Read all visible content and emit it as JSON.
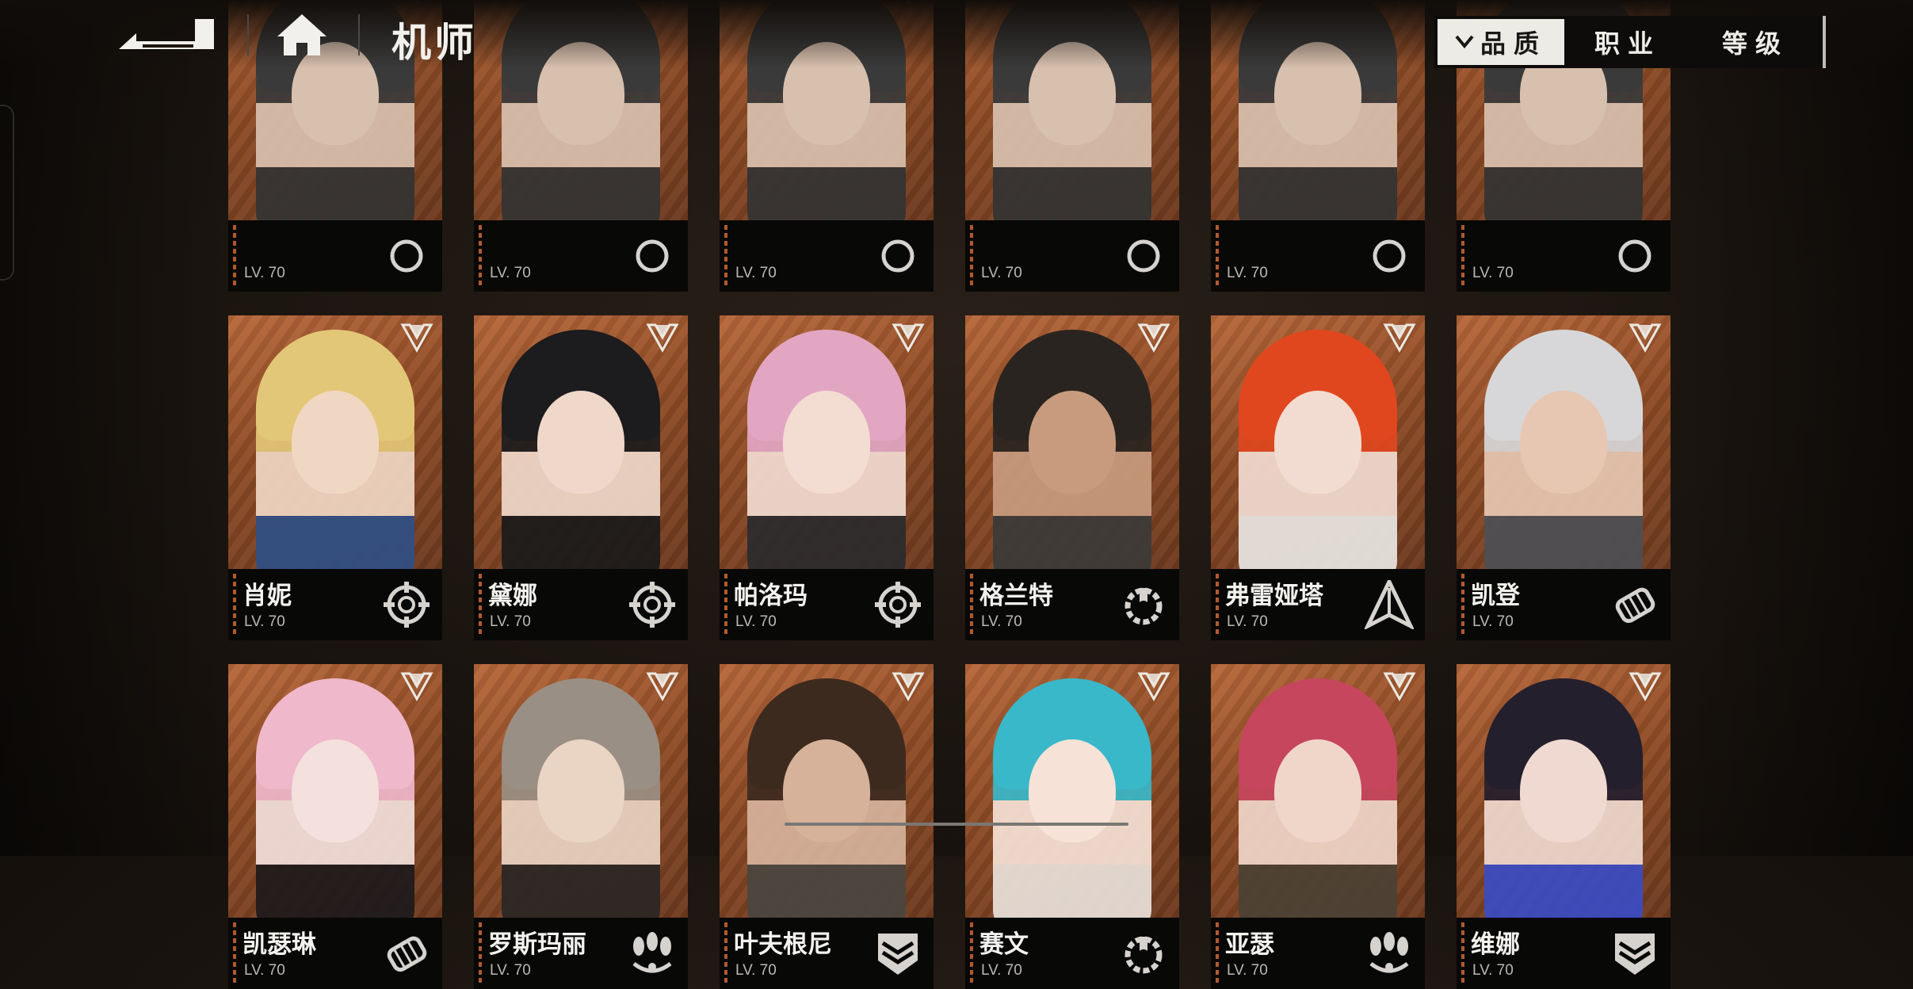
{
  "header": {
    "title": "机师",
    "back_icon": "back-arrow-icon",
    "home_icon": "home-icon"
  },
  "sort_tabs": [
    {
      "label": "品质",
      "active": true,
      "icon": "chevron-down-icon"
    },
    {
      "label": "职业",
      "active": false
    },
    {
      "label": "等级",
      "active": false
    }
  ],
  "pilots": [
    {
      "name": "",
      "level": "LV. 70",
      "class_icon": "class-icon"
    },
    {
      "name": "",
      "level": "LV. 70",
      "class_icon": "class-icon"
    },
    {
      "name": "",
      "level": "LV. 70",
      "class_icon": "class-icon"
    },
    {
      "name": "",
      "level": "LV. 70",
      "class_icon": "class-icon"
    },
    {
      "name": "",
      "level": "LV. 70",
      "class_icon": "class-icon"
    },
    {
      "name": "",
      "level": "LV. 70",
      "class_icon": "class-icon"
    },
    {
      "name": "肖妮",
      "level": "LV. 70",
      "class_icon": "crosshair-icon",
      "hair": "#e3c778",
      "skin": "#f0d7c4",
      "cloth": "#2f4f86"
    },
    {
      "name": "黛娜",
      "level": "LV. 70",
      "class_icon": "crosshair-icon",
      "hair": "#1c1b1d",
      "skin": "#efd8c9",
      "cloth": "#1a1a1a"
    },
    {
      "name": "帕洛玛",
      "level": "LV. 70",
      "class_icon": "crosshair-icon",
      "hair": "#e2a6c3",
      "skin": "#f3dcd2",
      "cloth": "#2b2b2d"
    },
    {
      "name": "格兰特",
      "level": "LV. 70",
      "class_icon": "wrench-gear-icon",
      "hair": "#2a2420",
      "skin": "#c89b7e",
      "cloth": "#3b3a38"
    },
    {
      "name": "弗雷娅塔",
      "level": "LV. 70",
      "class_icon": "arrowhead-icon",
      "hair": "#e0471f",
      "skin": "#f2dcd1",
      "cloth": "#e9e7e3"
    },
    {
      "name": "凯登",
      "level": "LV. 70",
      "class_icon": "fist-icon",
      "hair": "#d7d7d9",
      "skin": "#e7c7b1",
      "cloth": "#4d4f55"
    },
    {
      "name": "凯瑟琳",
      "level": "LV. 70",
      "class_icon": "fist-icon",
      "hair": "#f0b8cb",
      "skin": "#f4e0dc",
      "cloth": "#1d1a1c"
    },
    {
      "name": "罗斯玛丽",
      "level": "LV. 70",
      "class_icon": "bombs-icon",
      "hair": "#9a8f84",
      "skin": "#ead4c3",
      "cloth": "#2a2624"
    },
    {
      "name": "叶夫根尼",
      "level": "LV. 70",
      "class_icon": "shield-chevron-icon",
      "hair": "#3d2a1f",
      "skin": "#d6b29b",
      "cloth": "#4a4640"
    },
    {
      "name": "赛文",
      "level": "LV. 70",
      "class_icon": "wrench-gear-icon",
      "hair": "#39b8c9",
      "skin": "#f6e2d6",
      "cloth": "#e9e1da"
    },
    {
      "name": "亚瑟",
      "level": "LV. 70",
      "class_icon": "bombs-icon",
      "hair": "#c6465d",
      "skin": "#f0d6c8",
      "cloth": "#4b4134"
    },
    {
      "name": "维娜",
      "level": "LV. 70",
      "class_icon": "shield-chevron-icon",
      "hair": "#241f2c",
      "skin": "#efd9d0",
      "cloth": "#3a4cc4"
    }
  ]
}
